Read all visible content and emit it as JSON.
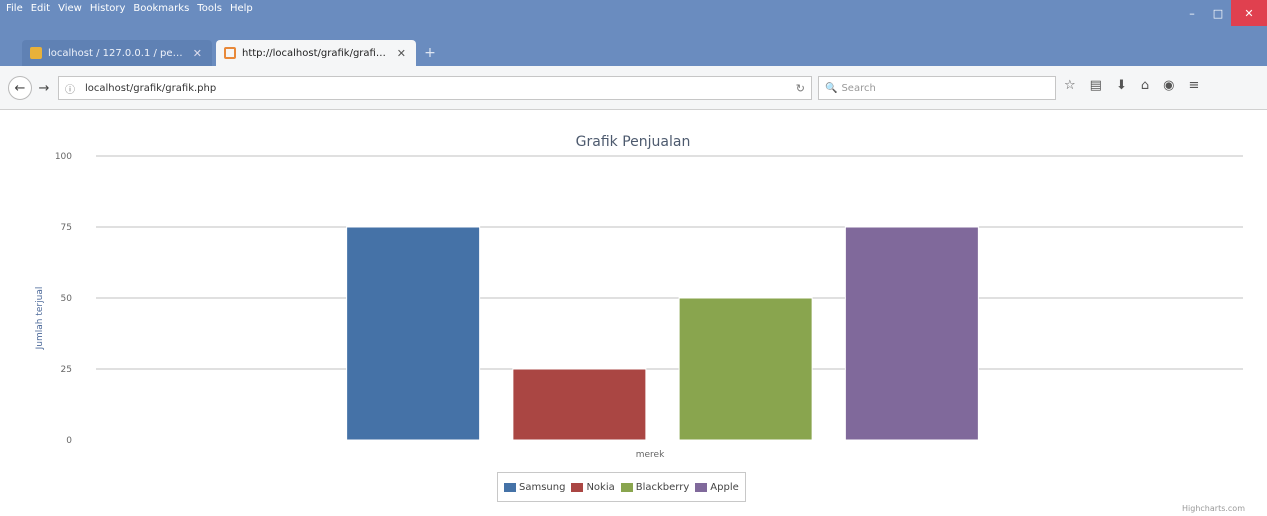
{
  "menu": [
    "File",
    "Edit",
    "View",
    "History",
    "Bookmarks",
    "Tools",
    "Help"
  ],
  "window": {
    "minimize": "–",
    "maximize": "□",
    "close": "✕"
  },
  "tabs": [
    {
      "label": "localhost / 127.0.0.1 / penjualan",
      "close": "✕"
    },
    {
      "label": "http://localhost/grafik/grafik.php",
      "close": "✕"
    }
  ],
  "newtab": "+",
  "toolbar": {
    "back": "←",
    "forward": "→",
    "info": "ⓘ",
    "url": "localhost/grafik/grafik.php",
    "reload": "↻",
    "search_icon": "🔍",
    "search_placeholder": "Search",
    "icons": [
      "☆",
      "▤",
      "⬇",
      "⌂",
      "◉",
      "≡"
    ]
  },
  "chart_data": {
    "type": "bar",
    "title": "Grafik Penjualan",
    "xlabel": "merek",
    "ylabel": "Jumlah terjual",
    "ylim": [
      0,
      100
    ],
    "ticks": [
      0,
      25,
      50,
      75,
      100
    ],
    "series": [
      {
        "name": "Samsung",
        "values": [
          75
        ],
        "color": "#4572a7"
      },
      {
        "name": "Nokia",
        "values": [
          25
        ],
        "color": "#aa4643"
      },
      {
        "name": "Blackberry",
        "values": [
          50
        ],
        "color": "#89a54e"
      },
      {
        "name": "Apple",
        "values": [
          75
        ],
        "color": "#80699b"
      }
    ],
    "grid": true,
    "legend": "bottom-center"
  },
  "credit": "Highcharts.com"
}
